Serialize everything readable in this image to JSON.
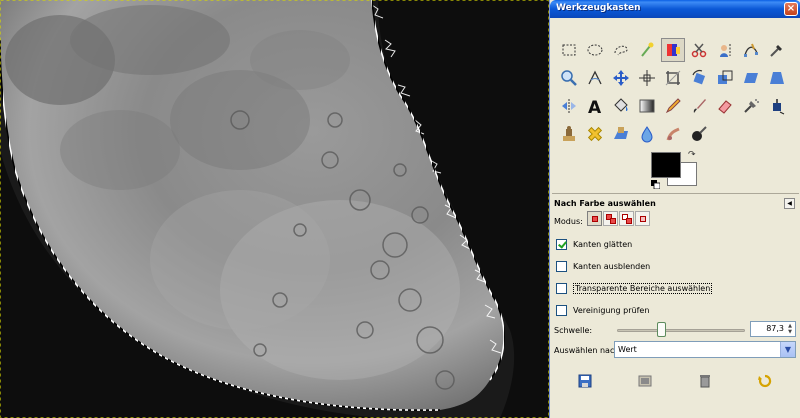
{
  "window": {
    "title": "Werkzeugkasten",
    "close_glyph": "×"
  },
  "tools": [
    "rect-select-icon",
    "ellipse-select-icon",
    "free-select-icon",
    "fuzzy-select-icon",
    "select-by-color-icon",
    "scissors-select-icon",
    "foreground-select-icon",
    "paths-icon",
    "color-picker-icon",
    "zoom-icon",
    "measure-icon",
    "move-icon",
    "align-icon",
    "crop-icon",
    "rotate-icon",
    "scale-icon",
    "shear-icon",
    "perspective-icon",
    "flip-icon",
    "text-icon",
    "bucket-fill-icon",
    "blend-icon",
    "pencil-icon",
    "paintbrush-icon",
    "eraser-icon",
    "airbrush-icon",
    "ink-icon",
    "clone-icon",
    "heal-icon",
    "perspective-clone-icon",
    "blur-icon",
    "smudge-icon",
    "dodge-burn-icon"
  ],
  "active_tool_index": 4,
  "colors": {
    "foreground": "#000000",
    "background": "#ffffff"
  },
  "options": {
    "title": "Nach Farbe auswählen",
    "menu_glyph": "◀",
    "mode_label": "Modus:",
    "checkboxes": [
      {
        "label": "Kanten glätten",
        "checked": true
      },
      {
        "label": "Kanten ausblenden",
        "checked": false
      },
      {
        "label": "Transparente Bereiche auswählen",
        "checked": false
      },
      {
        "label": "Vereinigung prüfen",
        "checked": false
      }
    ],
    "threshold_label": "Schwelle:",
    "threshold_value": "87,3",
    "threshold_fraction": 0.34,
    "select_by_label": "Auswählen nach:",
    "select_by_value": "Wert"
  }
}
